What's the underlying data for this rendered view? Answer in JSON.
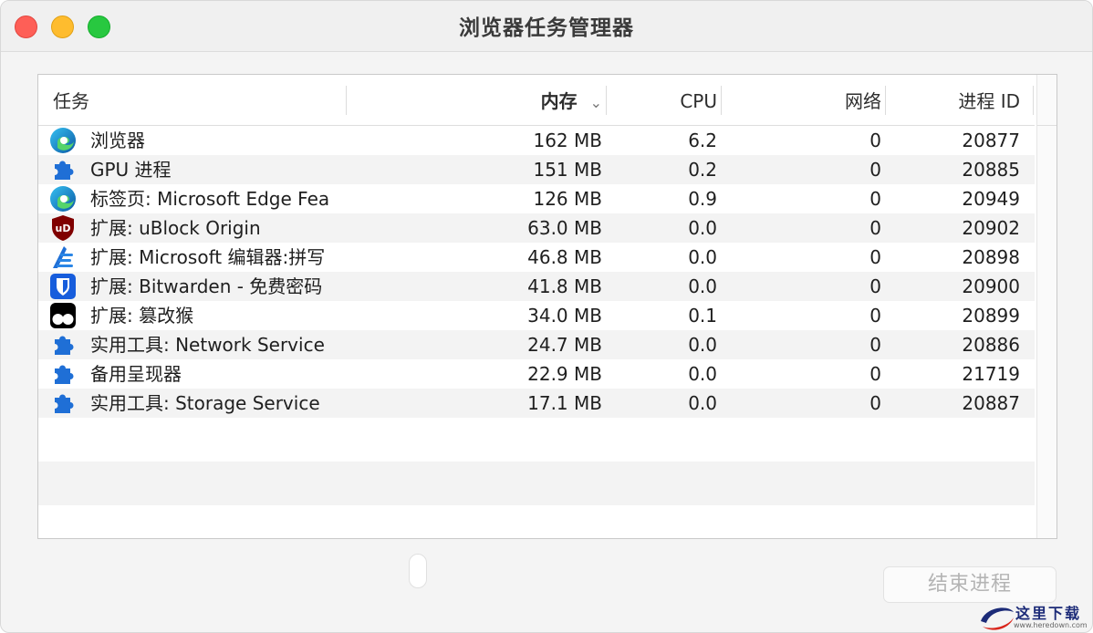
{
  "window": {
    "title": "浏览器任务管理器"
  },
  "columns": {
    "task": "任务",
    "memory": "内存",
    "memory_sort_icon": "chevron-down-icon",
    "cpu": "CPU",
    "network": "网络",
    "pid": "进程 ID"
  },
  "rows": [
    {
      "icon": "edge-browser-icon",
      "name": "浏览器",
      "memory": "162 MB",
      "cpu": "6.2",
      "network": "0",
      "pid": "20877"
    },
    {
      "icon": "puzzle-icon",
      "name": "GPU 进程",
      "memory": "151 MB",
      "cpu": "0.2",
      "network": "0",
      "pid": "20885"
    },
    {
      "icon": "edge-browser-icon",
      "name": "标签页: Microsoft Edge Fea",
      "memory": "126 MB",
      "cpu": "0.9",
      "network": "0",
      "pid": "20949"
    },
    {
      "icon": "ublock-icon",
      "name": "扩展: uBlock Origin",
      "memory": "63.0 MB",
      "cpu": "0.0",
      "network": "0",
      "pid": "20902"
    },
    {
      "icon": "microsoft-editor-icon",
      "name": "扩展: Microsoft 编辑器:拼写",
      "memory": "46.8 MB",
      "cpu": "0.0",
      "network": "0",
      "pid": "20898"
    },
    {
      "icon": "bitwarden-icon",
      "name": "扩展: Bitwarden - 免费密码",
      "memory": "41.8 MB",
      "cpu": "0.0",
      "network": "0",
      "pid": "20900"
    },
    {
      "icon": "tampermonkey-icon",
      "name": "扩展: 篡改猴",
      "memory": "34.0 MB",
      "cpu": "0.1",
      "network": "0",
      "pid": "20899"
    },
    {
      "icon": "puzzle-icon",
      "name": "实用工具: Network Service",
      "memory": "24.7 MB",
      "cpu": "0.0",
      "network": "0",
      "pid": "20886"
    },
    {
      "icon": "puzzle-icon",
      "name": "备用呈现器",
      "memory": "22.9 MB",
      "cpu": "0.0",
      "network": "0",
      "pid": "21719"
    },
    {
      "icon": "puzzle-icon",
      "name": "实用工具: Storage Service",
      "memory": "17.1 MB",
      "cpu": "0.0",
      "network": "0",
      "pid": "20887"
    }
  ],
  "actions": {
    "end_process": "结束进程"
  },
  "watermark": {
    "text": "这里下载",
    "url": "www.heredown.com"
  },
  "colors": {
    "close": "#fe5f57",
    "minimize": "#febc2e",
    "maximize": "#28c840",
    "icon_blue": "#1f6fd6",
    "ublock_red": "#800000",
    "bitwarden_blue": "#175ddc"
  }
}
